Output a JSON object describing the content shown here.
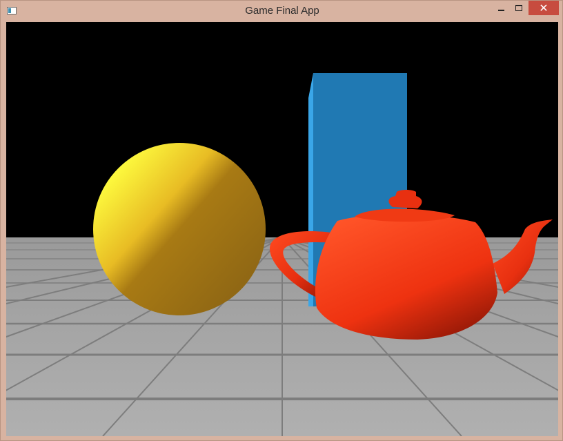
{
  "window": {
    "title": "Game Final App",
    "controls": {
      "close_glyph": "✕"
    }
  },
  "scene": {
    "background_color": "#000000",
    "objects": [
      {
        "name": "sphere",
        "color": "#f0c020"
      },
      {
        "name": "box",
        "color": "#2079b3"
      },
      {
        "name": "teapot",
        "color": "#e83010"
      },
      {
        "name": "floor",
        "color": "#a8a8a8",
        "texture": "tiles"
      }
    ]
  }
}
